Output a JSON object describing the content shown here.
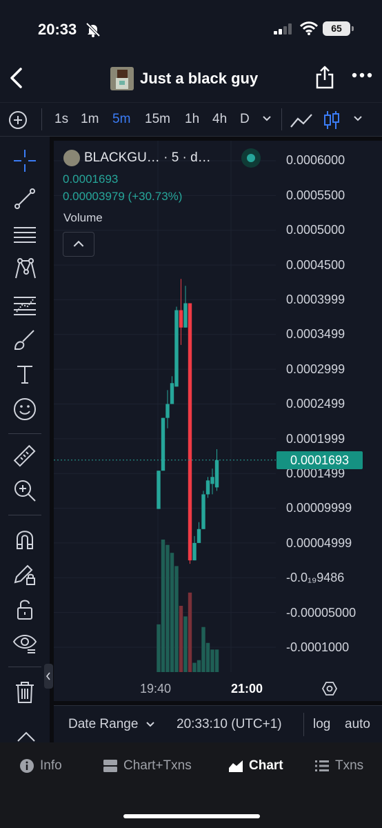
{
  "status_bar": {
    "time": "20:33",
    "battery": "65"
  },
  "header": {
    "title": "Just a black guy"
  },
  "toolbar": {
    "timeframes": [
      "1s",
      "1m",
      "5m",
      "15m",
      "1h",
      "4h",
      "D"
    ],
    "active_timeframe": "5m"
  },
  "legend": {
    "symbol": "BLACKGU… · 5 · d…",
    "price": "0.0001693",
    "change": "0.00003979 (+30.73%)",
    "volume_label": "Volume"
  },
  "price_axis": {
    "labels": [
      "0.0006000",
      "0.0005500",
      "0.0005000",
      "0.0004500",
      "0.0003999",
      "0.0003499",
      "0.0002999",
      "0.0002499",
      "0.0001999",
      "0.0001499",
      "0.00009999",
      "0.00004999",
      "-0.0₁₉9486",
      "-0.00005000",
      "-0.0001000"
    ],
    "current_price_tag": "0.0001693"
  },
  "time_axis": {
    "labels": [
      "19:40",
      "21:00"
    ]
  },
  "range_bar": {
    "date_range": "Date Range",
    "timestamp": "20:33:10 (UTC+1)",
    "log": "log",
    "auto": "auto"
  },
  "bottom_nav": {
    "items": [
      "Info",
      "Chart+Txns",
      "Chart",
      "Txns"
    ],
    "active": "Chart"
  },
  "colors": {
    "up": "#26a69a",
    "down": "#ef3b45",
    "accent": "#3b7cf6"
  },
  "chart_data": {
    "type": "candlestick",
    "ylim": [
      -0.0001,
      0.0006
    ],
    "current_price": 0.0001693,
    "candles": [
      {
        "o": 9.9e-05,
        "h": 0.000154,
        "l": 9.9e-05,
        "c": 0.000154
      },
      {
        "o": 0.000154,
        "h": 0.00023,
        "l": 0.000154,
        "c": 0.00023
      },
      {
        "o": 0.00023,
        "h": 0.00027,
        "l": 0.000215,
        "c": 0.00025
      },
      {
        "o": 0.00025,
        "h": 0.00029,
        "l": 0.00025,
        "c": 0.00028
      },
      {
        "o": 0.000275,
        "h": 0.00039,
        "l": 0.000275,
        "c": 0.000385
      },
      {
        "o": 0.000385,
        "h": 0.00043,
        "l": 0.000335,
        "c": 0.00036
      },
      {
        "o": 0.00036,
        "h": 0.00042,
        "l": 0.00036,
        "c": 0.000395
      },
      {
        "o": 0.000395,
        "h": 0.000395,
        "l": 2e-05,
        "c": 2.5e-05
      },
      {
        "o": 2.5e-05,
        "h": 6e-05,
        "l": 2.5e-05,
        "c": 5e-05
      },
      {
        "o": 5e-05,
        "h": 8e-05,
        "l": 5e-05,
        "c": 7e-05
      },
      {
        "o": 7e-05,
        "h": 0.000125,
        "l": 7e-05,
        "c": 0.00012
      },
      {
        "o": 0.00012,
        "h": 0.000145,
        "l": 0.000115,
        "c": 0.00014
      },
      {
        "o": 0.000135,
        "h": 0.000157,
        "l": 0.00012,
        "c": 0.000145
      },
      {
        "o": 0.00013,
        "h": 0.000185,
        "l": 0.000125,
        "c": 0.0001693
      }
    ],
    "volume_relative": [
      0.36,
      1.0,
      0.96,
      0.9,
      0.8,
      0.5,
      0.42,
      0.6,
      0.07,
      0.09,
      0.34,
      0.22,
      0.17,
      0.17
    ]
  }
}
